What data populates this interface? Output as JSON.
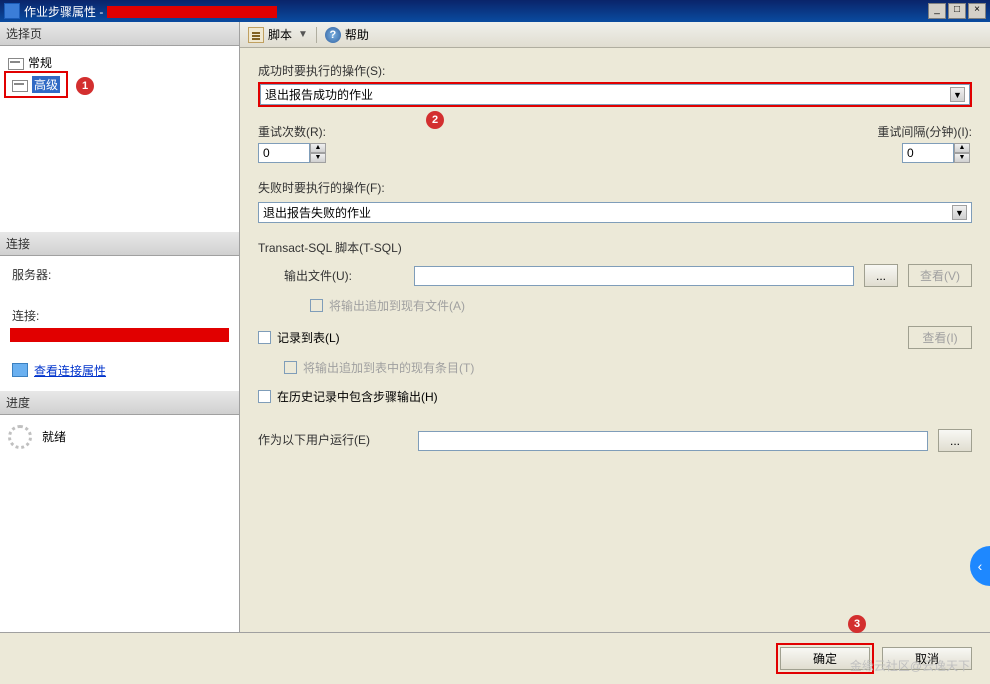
{
  "titlebar": {
    "icon": "window-icon",
    "prefix": "作业步骤属性 - ",
    "buttons": {
      "minimize": "_",
      "maximize": "□",
      "close": "×"
    }
  },
  "left": {
    "select_page_header": "选择页",
    "nav_general": "常规",
    "nav_advanced": "高级",
    "connection_header": "连接",
    "server_label": "服务器:",
    "conn_label": "连接:",
    "view_conn_props": "查看连接属性",
    "progress_header": "进度",
    "progress_status": "就绪"
  },
  "toolbar": {
    "script_label": "脚本",
    "help_label": "帮助"
  },
  "form": {
    "success_action_label": "成功时要执行的操作(S):",
    "success_action_value": "退出报告成功的作业",
    "retry_count_label": "重试次数(R):",
    "retry_count_value": "0",
    "retry_interval_label": "重试间隔(分钟)(I):",
    "retry_interval_value": "0",
    "failure_action_label": "失败时要执行的操作(F):",
    "failure_action_value": "退出报告失败的作业",
    "tsql_header": "Transact-SQL 脚本(T-SQL)",
    "output_file_label": "输出文件(U):",
    "output_file_value": "",
    "append_file_label": "将输出追加到现有文件(A)",
    "log_to_table_label": "记录到表(L)",
    "append_table_label": "将输出追加到表中的现有条目(T)",
    "include_history_label": "在历史记录中包含步骤输出(H)",
    "run_as_label": "作为以下用户运行(E)",
    "run_as_value": "",
    "view_btn": "查看(V)",
    "view_btn2": "查看(I)",
    "ellipsis": "..."
  },
  "footer": {
    "ok": "确定",
    "cancel": "取消"
  },
  "annotations": {
    "m1": "1",
    "m2": "2",
    "m3": "3"
  },
  "watermark": "金缘云社区@云逸天下"
}
